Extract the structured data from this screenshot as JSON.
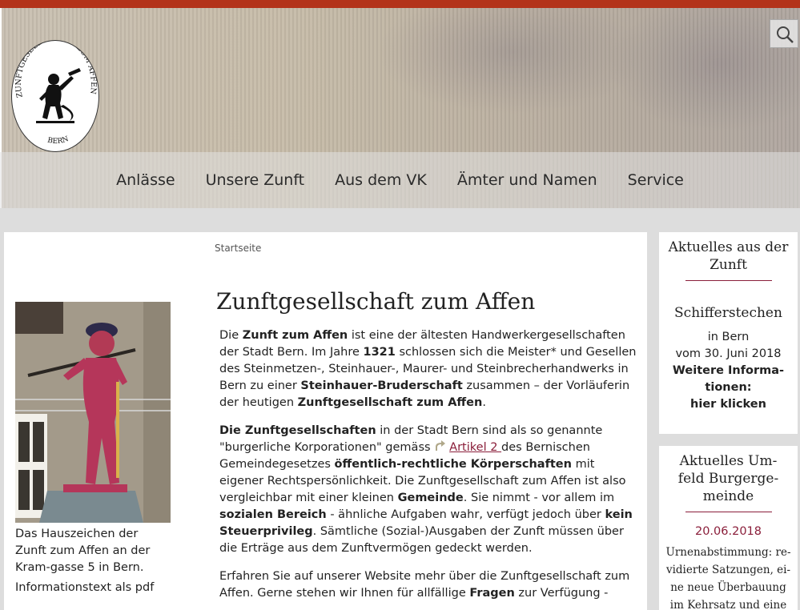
{
  "header": {
    "logo_text_top": "ZUNFTGESELLSCHAFT ZUM AFFEN",
    "logo_text_bottom": "BERN",
    "search_icon": "search-icon"
  },
  "nav": {
    "items": [
      {
        "label": "Anlässe"
      },
      {
        "label": "Unsere Zunft"
      },
      {
        "label": "Aus dem VK"
      },
      {
        "label": "Ämter und Namen"
      },
      {
        "label": "Service"
      }
    ]
  },
  "breadcrumb": "Startseite",
  "figure": {
    "caption": "Das Hauszeichen der Zunft zum Affen an der Kram-gasse 5 in Bern.",
    "pdf_link": "Informationstext als pdf"
  },
  "main": {
    "title": "Zunftgesellschaft zum Affen",
    "p1": {
      "t1": "Die ",
      "b1": "Zunft zum Affen",
      "t2": " ist eine der ältesten Handwerkergesellschaften der Stadt Bern. Im Jahre ",
      "b2": "1321",
      "t3": " schlossen sich die Meister* und Gesellen des Steinmetzen-, Steinhauer-, Maurer- und Steinbrecherhandwerks in Bern zu einer ",
      "b3": "Steinhauer-Bruderschaft",
      "t4": " zusammen – der Vorläuferin der heutigen ",
      "b4": "Zunftgesellschaft zum Affen",
      "t5": "."
    },
    "p2": {
      "b1": "Die Zunftgesellschaften",
      "t1": " in der Stadt Bern sind als so genannte \"burgerliche Korporationen\" gemäss ",
      "link": "Artikel 2 ",
      "t2": "des Bernischen Gemeindegesetzes ",
      "b2": "öffentlich-rechtliche Körperschaften",
      "t3": " mit eigener Rechtspersönlichkeit. Die Zunftgesellschaft zum Affen ist also vergleichbar mit einer kleinen ",
      "b3": "Gemeinde",
      "t4": ". Sie nimmt - vor allem im ",
      "b4": "sozialen Bereich",
      "t5": " - ähnliche Aufgaben wahr, verfügt jedoch über ",
      "b5": "kein Steuerprivileg",
      "t6": ". Sämtliche (Sozial-)Ausgaben der Zunft müssen über die Erträge aus dem Zunftvermögen gedeckt werden."
    },
    "p3": {
      "t1": "Erfahren Sie auf unserer Website mehr über die Zunftgesellschaft zum Affen. Gerne stehen wir Ihnen für allfällige ",
      "b1": "Fragen",
      "t2": " zur Verfügung -"
    }
  },
  "sidebar": {
    "box1": {
      "title": "Aktuelles aus der Zunft",
      "event_title": "Schifferstechen",
      "line1": "in Bern",
      "line2": "vom 30. Juni 2018",
      "more1": "Weitere Informa-",
      "more2": "tionen:",
      "more3": "hier klicken"
    },
    "box2": {
      "title": "Aktuelles Um-feld Burgerge-meinde",
      "date": "20.06.2018",
      "news": "Urnenabstimmung: re-vidierte Satzungen, ei-ne neue Überbauung im Kehrsatz und eine Ge-"
    }
  },
  "colors": {
    "topbar": "#b3331a",
    "accent": "#8a1e3a"
  }
}
